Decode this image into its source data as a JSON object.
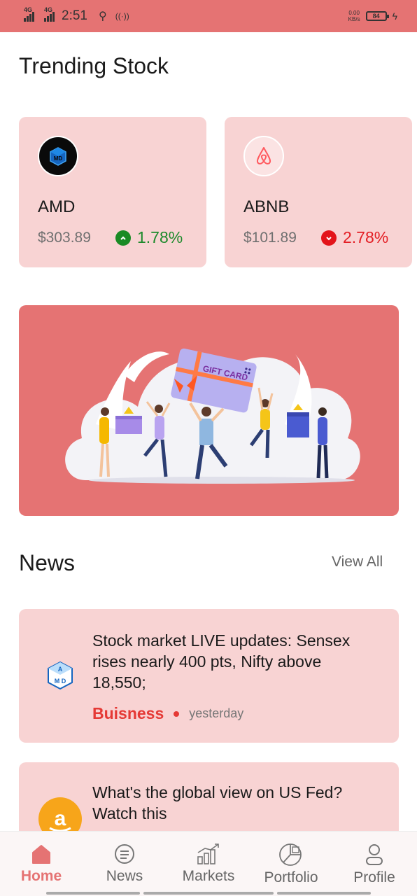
{
  "status_bar": {
    "net1": "4G",
    "net2": "4G",
    "time": "2:51",
    "speed": "0.00",
    "speed_unit": "KB/s",
    "battery": "84"
  },
  "trending": {
    "title": "Trending Stock",
    "stocks": [
      {
        "ticker": "AMD",
        "price": "$303.89",
        "change": "1.78%",
        "direction": "up"
      },
      {
        "ticker": "ABNB",
        "price": "$101.89",
        "change": "2.78%",
        "direction": "down"
      }
    ]
  },
  "banner": {
    "gift_card_text": "GIFT CARD"
  },
  "news": {
    "title": "News",
    "view_all": "View All",
    "items": [
      {
        "title": "Stock market LIVE updates: Sensex rises nearly 400 pts, Nifty above 18,550;",
        "category": "Buisness",
        "time": "yesterday",
        "logo_text": "AMD"
      },
      {
        "title": "What's the global view on US Fed? Watch this",
        "logo_text": "a"
      }
    ]
  },
  "bottom_nav": {
    "items": [
      {
        "label": "Home",
        "icon": "home-icon",
        "active": true
      },
      {
        "label": "News",
        "icon": "news-icon",
        "active": false
      },
      {
        "label": "Markets",
        "icon": "markets-icon",
        "active": false
      },
      {
        "label": "Portfolio",
        "icon": "portfolio-icon",
        "active": false
      },
      {
        "label": "Profile",
        "icon": "profile-icon",
        "active": false
      }
    ]
  },
  "colors": {
    "accent": "#e57373",
    "card_bg": "#f8d3d3",
    "up": "#1a8a24",
    "down": "#e3141a"
  }
}
